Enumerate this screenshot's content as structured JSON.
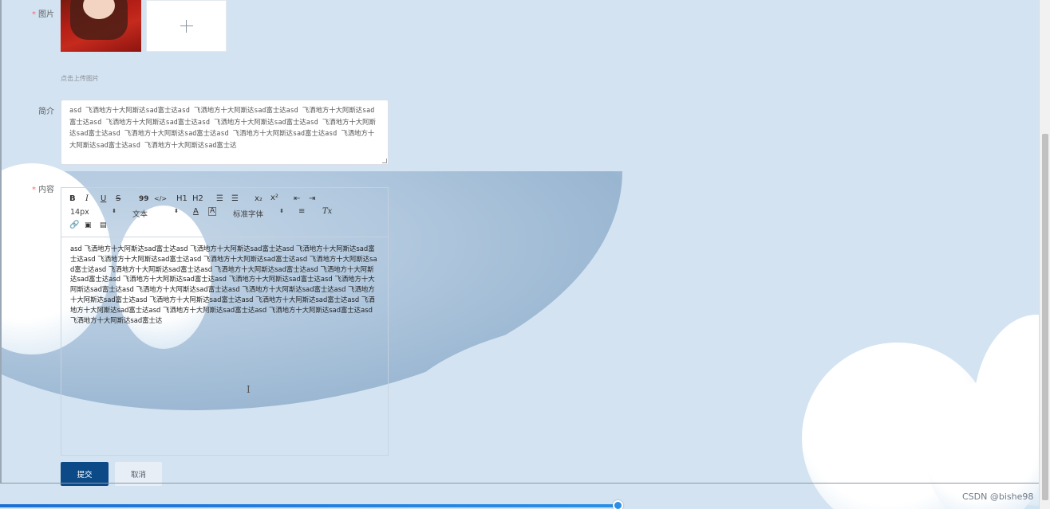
{
  "form": {
    "image_label": "图片",
    "image_hint": "点击上传图片",
    "intro_label": "简介",
    "intro_value": "asd 飞洒地方十大阿斯达sad富士达asd 飞洒地方十大阿斯达sad富士达asd 飞洒地方十大阿斯达sad富士达asd 飞洒地方十大阿斯达sad富士达asd 飞洒地方十大阿斯达sad富士达asd 飞洒地方十大阿斯达sad富士达asd 飞洒地方十大阿斯达sad富士达asd 飞洒地方十大阿斯达sad富士达asd 飞洒地方十大阿斯达sad富士达asd 飞洒地方十大阿斯达sad富士达",
    "content_label": "内容",
    "submit_label": "提交",
    "cancel_label": "取消"
  },
  "editor": {
    "font_size": "14px",
    "block_type": "文本",
    "font_family": "标准字体",
    "buttons": {
      "bold": "B",
      "italic": "I",
      "underline": "U",
      "strike": "S",
      "blockquote": "99",
      "code": "</>",
      "h1": "H1",
      "h2": "H2",
      "ordered_list": "☰",
      "bullet_list": "☰",
      "subscript": "x₂",
      "superscript": "x²",
      "outdent": "⇤",
      "indent": "⇥",
      "align": "≡",
      "clean": "Tx"
    },
    "body_text": "asd 飞洒地方十大阿斯达sad富士达asd 飞洒地方十大阿斯达sad富士达asd 飞洒地方十大阿斯达sad富士达asd 飞洒地方十大阿斯达sad富士达asd 飞洒地方十大阿斯达sad富士达asd 飞洒地方十大阿斯达sad富士达asd 飞洒地方十大阿斯达sad富士达asd 飞洒地方十大阿斯达sad富士达asd 飞洒地方十大阿斯达sad富士达asd 飞洒地方十大阿斯达sad富士达asd 飞洒地方十大阿斯达sad富士达asd 飞洒地方十大阿斯达sad富士达asd 飞洒地方十大阿斯达sad富士达asd 飞洒地方十大阿斯达sad富士达asd 飞洒地方十大阿斯达sad富士达asd 飞洒地方十大阿斯达sad富士达asd 飞洒地方十大阿斯达sad富士达asd 飞洒地方十大阿斯达sad富士达asd 飞洒地方十大阿斯达sad富士达asd 飞洒地方十大阿斯达sad富士达asd 飞洒地方十大阿斯达sad富士达"
  },
  "watermark": "CSDN @bishe98",
  "colors": {
    "background": "#d3e3f1",
    "submit_button": "#0b4a86",
    "required_star": "#f56c6c",
    "progress": "#2a8ee8"
  }
}
